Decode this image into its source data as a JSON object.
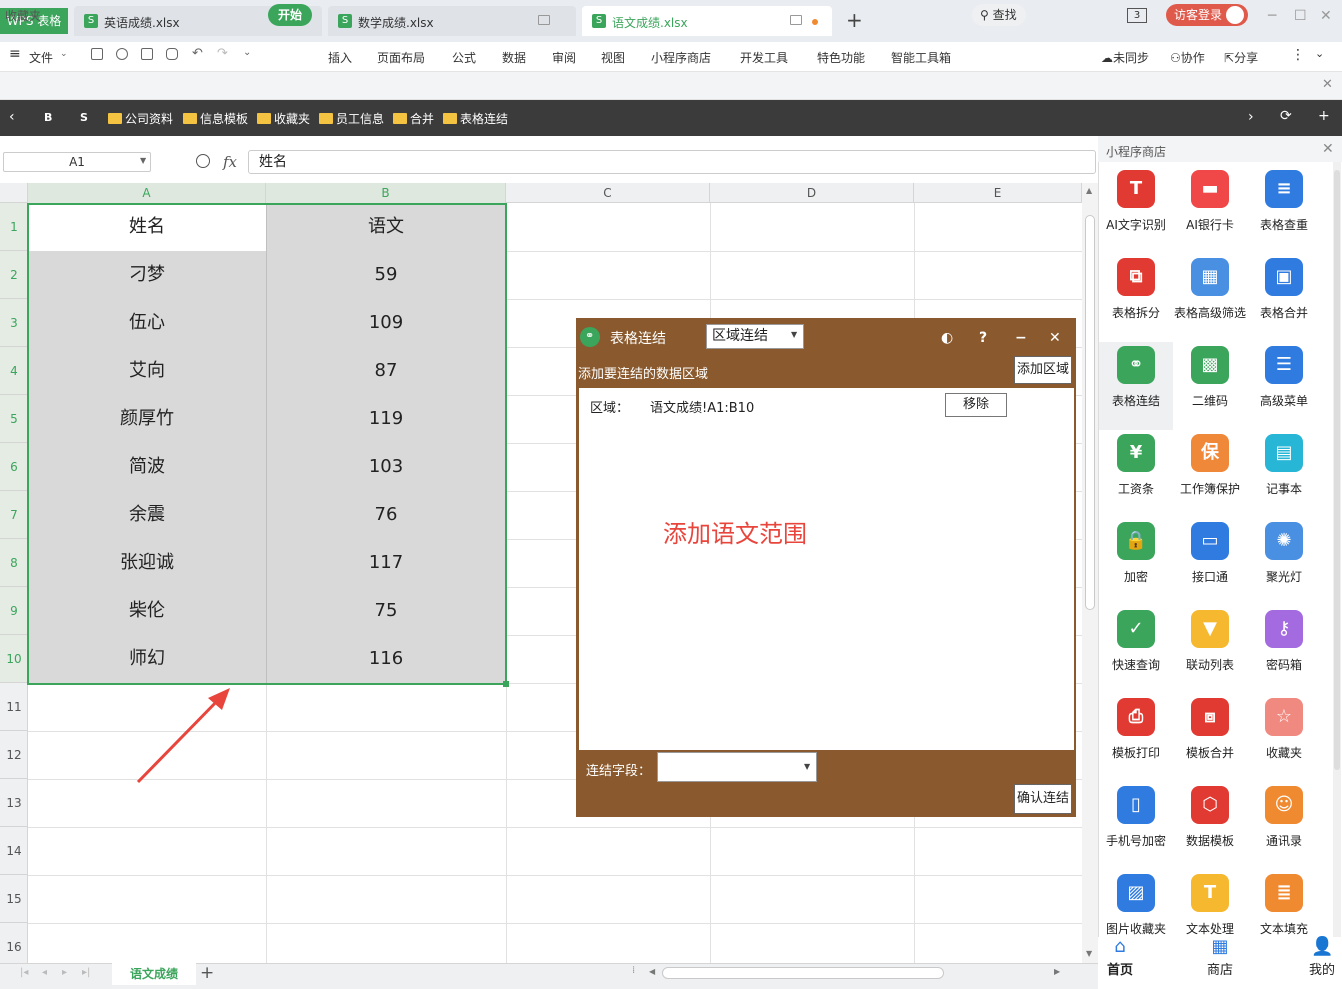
{
  "app": {
    "name": "WPS 表格"
  },
  "tabs": [
    {
      "label": "英语成绩.xlsx"
    },
    {
      "label": "数学成绩.xlsx"
    },
    {
      "label": "语文成绩.xlsx"
    }
  ],
  "titlebar": {
    "badge": "3",
    "login": "访客登录"
  },
  "menu": {
    "file": "文件",
    "items": [
      "开始",
      "插入",
      "页面布局",
      "公式",
      "数据",
      "审阅",
      "视图",
      "小程序商店",
      "开发工具",
      "特色功能",
      "智能工具箱"
    ],
    "search": "查找",
    "right": [
      "未同步",
      "协作",
      "分享"
    ]
  },
  "favorites": {
    "label": "收藏夹"
  },
  "bookmarks": {
    "nav": [
      "B",
      "S"
    ],
    "folders": [
      "公司资料",
      "信息模板",
      "收藏夹",
      "员工信息",
      "合并",
      "表格连结"
    ]
  },
  "formula": {
    "cell_ref": "A1",
    "fx": "fx",
    "value": "姓名"
  },
  "columns": [
    "A",
    "B",
    "C",
    "D",
    "E"
  ],
  "rows": [
    "1",
    "2",
    "3",
    "4",
    "5",
    "6",
    "7",
    "8",
    "9",
    "10",
    "11",
    "12",
    "13",
    "14",
    "15",
    "16"
  ],
  "table": {
    "header": [
      "姓名",
      "语文"
    ],
    "data": [
      [
        "刁梦",
        "59"
      ],
      [
        "伍心",
        "109"
      ],
      [
        "艾向",
        "87"
      ],
      [
        "颜厚竹",
        "119"
      ],
      [
        "简波",
        "103"
      ],
      [
        "余震",
        "76"
      ],
      [
        "张迎诚",
        "117"
      ],
      [
        "柴伦",
        "75"
      ],
      [
        "师幻",
        "116"
      ]
    ]
  },
  "sheet": {
    "name": "语文成绩"
  },
  "dialog": {
    "title": "表格连结",
    "mode": "区域连结",
    "subtitle": "添加要连结的数据区域",
    "add_area": "添加区域",
    "area_label": "区域：",
    "area_value": "语文成绩!A1:B10",
    "remove": "移除",
    "field_label": "连结字段：",
    "confirm": "确认连结",
    "help": "?",
    "minimize": "−",
    "close": "✕"
  },
  "annotation": {
    "text": "添加语文范围",
    "color": "#e8453c"
  },
  "panel": {
    "title": "小程序商店",
    "apps": [
      {
        "label": "AI文字识别",
        "glyph": "T",
        "color": "#e03a32"
      },
      {
        "label": "AI银行卡",
        "glyph": "▬",
        "color": "#f04848"
      },
      {
        "label": "表格查重",
        "glyph": "≡",
        "color": "#2f7be0"
      },
      {
        "label": "表格拆分",
        "glyph": "⧉",
        "color": "#e03a32"
      },
      {
        "label": "表格高级筛选",
        "glyph": "▦",
        "color": "#4a90e2"
      },
      {
        "label": "表格合并",
        "glyph": "▣",
        "color": "#2f7be0"
      },
      {
        "label": "表格连结",
        "glyph": "⚭",
        "color": "#3ca55c"
      },
      {
        "label": "二维码",
        "glyph": "▩",
        "color": "#3ca55c"
      },
      {
        "label": "高级菜单",
        "glyph": "☰",
        "color": "#2f7be0"
      },
      {
        "label": "工资条",
        "glyph": "¥",
        "color": "#3ca55c"
      },
      {
        "label": "工作簿保护",
        "glyph": "保",
        "color": "#f0883a"
      },
      {
        "label": "记事本",
        "glyph": "▤",
        "color": "#27b6d6"
      },
      {
        "label": "加密",
        "glyph": "🔒",
        "color": "#3ca55c"
      },
      {
        "label": "接口通",
        "glyph": "▭",
        "color": "#2f7be0"
      },
      {
        "label": "聚光灯",
        "glyph": "✺",
        "color": "#4a90e2"
      },
      {
        "label": "快速查询",
        "glyph": "✓",
        "color": "#3ca55c"
      },
      {
        "label": "联动列表",
        "glyph": "▼",
        "color": "#f5b82e"
      },
      {
        "label": "密码箱",
        "glyph": "⚷",
        "color": "#a46be0"
      },
      {
        "label": "模板打印",
        "glyph": "⎙",
        "color": "#e03a32"
      },
      {
        "label": "模板合并",
        "glyph": "⧈",
        "color": "#e03a32"
      },
      {
        "label": "收藏夹",
        "glyph": "☆",
        "color": "#f08a80"
      },
      {
        "label": "手机号加密",
        "glyph": "▯",
        "color": "#2f7be0"
      },
      {
        "label": "数据模板",
        "glyph": "⬡",
        "color": "#e03a32"
      },
      {
        "label": "通讯录",
        "glyph": "☺",
        "color": "#f08a30"
      },
      {
        "label": "图片收藏夹",
        "glyph": "▨",
        "color": "#2f7be0"
      },
      {
        "label": "文本处理",
        "glyph": "T",
        "color": "#f5b82e"
      },
      {
        "label": "文本填充",
        "glyph": "≣",
        "color": "#f08a30"
      }
    ],
    "footer": [
      "首页",
      "商店",
      "我的"
    ]
  }
}
